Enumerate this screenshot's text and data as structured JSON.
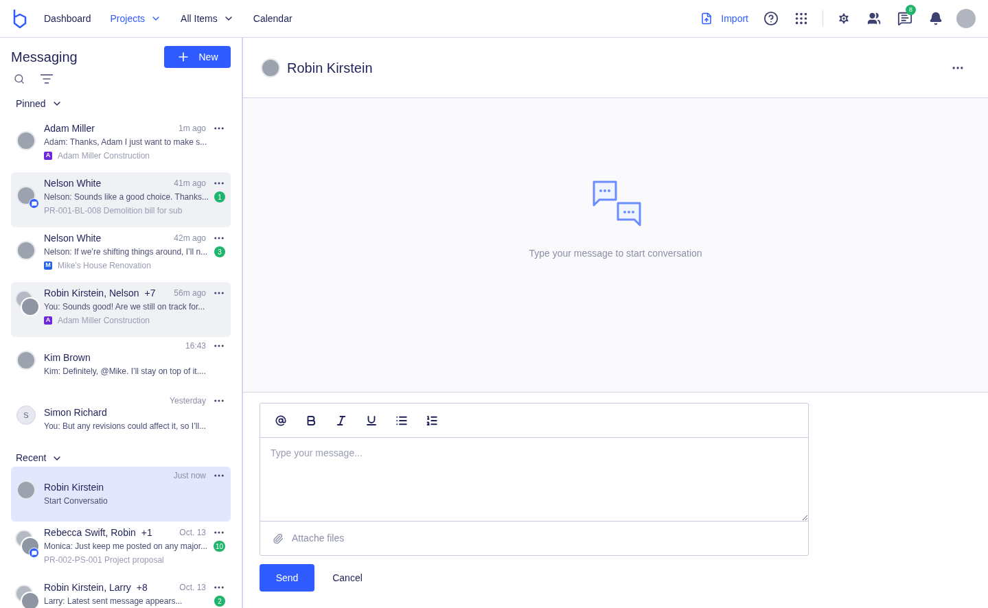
{
  "nav": {
    "items": [
      {
        "label": "Dashboard",
        "selected": false,
        "dropdown": false
      },
      {
        "label": "Projects",
        "selected": true,
        "dropdown": true
      },
      {
        "label": "All Items",
        "selected": false,
        "dropdown": true
      },
      {
        "label": "Calendar",
        "selected": false,
        "dropdown": false
      }
    ],
    "import_label": "Import",
    "chat_badge": "8"
  },
  "sidebar": {
    "title": "Messaging",
    "new_button": "New",
    "sections": [
      {
        "label": "Pinned",
        "expanded": true,
        "conversations": [
          {
            "kind": "single",
            "name": "Adam Miller",
            "time": "1m ago",
            "preview": "Adam: Thanks, Adam I just want to make s...",
            "project": {
              "letter": "A",
              "color": "#6d28d9",
              "name": "Adam Miller Construction"
            },
            "chat_badge": false,
            "selected": false,
            "highlighted": false
          },
          {
            "kind": "single",
            "name": "Nelson White",
            "time": "41m ago",
            "preview": "Nelson: Sounds like a good choice. Thanks...",
            "ref": "PR-001-BL-008 Demolition bill for sub",
            "unread": "1",
            "chat_badge": true,
            "selected": false,
            "highlighted": true
          },
          {
            "kind": "single",
            "name": "Nelson White",
            "time": "42m ago",
            "preview": "Nelson: If we’re shifting things around, I’ll n...",
            "project": {
              "letter": "M",
              "color": "#2563eb",
              "name": "Mike’s House Renovation"
            },
            "unread": "3",
            "chat_badge": false,
            "selected": false,
            "highlighted": false
          },
          {
            "kind": "group",
            "name": "Robin Kirstein, Nelson",
            "extra": "+7",
            "time": "56m ago",
            "preview": "You: Sounds good! Are we still on track for...",
            "project": {
              "letter": "A",
              "color": "#6d28d9",
              "name": "Adam Miller Construction"
            },
            "chat_badge": false,
            "selected": false,
            "highlighted": true
          },
          {
            "kind": "single",
            "name": "Kim Brown",
            "time": "16:43",
            "preview": "Kim: Definitely, @Mike. I’ll stay on top of it....",
            "chat_badge": false,
            "selected": false,
            "highlighted": false
          },
          {
            "kind": "initial",
            "name": "Simon Richard",
            "initial": "S",
            "time": "Yesterday",
            "preview": "You: But any revisions could affect it, so I’ll...",
            "chat_badge": false,
            "selected": false,
            "highlighted": false
          }
        ]
      },
      {
        "label": "Recent",
        "expanded": true,
        "conversations": [
          {
            "kind": "single",
            "name": "Robin Kirstein",
            "time": "Just now",
            "preview": "Start Conversatio",
            "chat_badge": false,
            "selected": true
          },
          {
            "kind": "group",
            "name": "Rebecca Swift, Robin",
            "extra": "+1",
            "time": "Oct. 13",
            "preview": "Monica: Just keep me posted on any major...",
            "ref": "PR-002-PS-001 Project proposal",
            "unread": "10",
            "chat_badge": true,
            "selected": false,
            "highlighted": false
          },
          {
            "kind": "group",
            "name": "Robin Kirstein, Larry",
            "extra": "+8",
            "time": "Oct. 13",
            "preview": "Larry: Latest sent message appears...",
            "unread": "2",
            "chat_badge": false,
            "selected": false,
            "highlighted": false
          }
        ]
      }
    ]
  },
  "conversation": {
    "title": "Robin Kirstein",
    "empty_text": "Type your message to start conversation"
  },
  "composer": {
    "tools": [
      {
        "kind": "mention"
      },
      {
        "kind": "bold"
      },
      {
        "kind": "italic"
      },
      {
        "kind": "underline"
      },
      {
        "kind": "bullets"
      },
      {
        "kind": "numbered"
      }
    ],
    "placeholder": "Type your message...",
    "attach_label": "Attache files",
    "send": "Send",
    "cancel": "Cancel"
  }
}
